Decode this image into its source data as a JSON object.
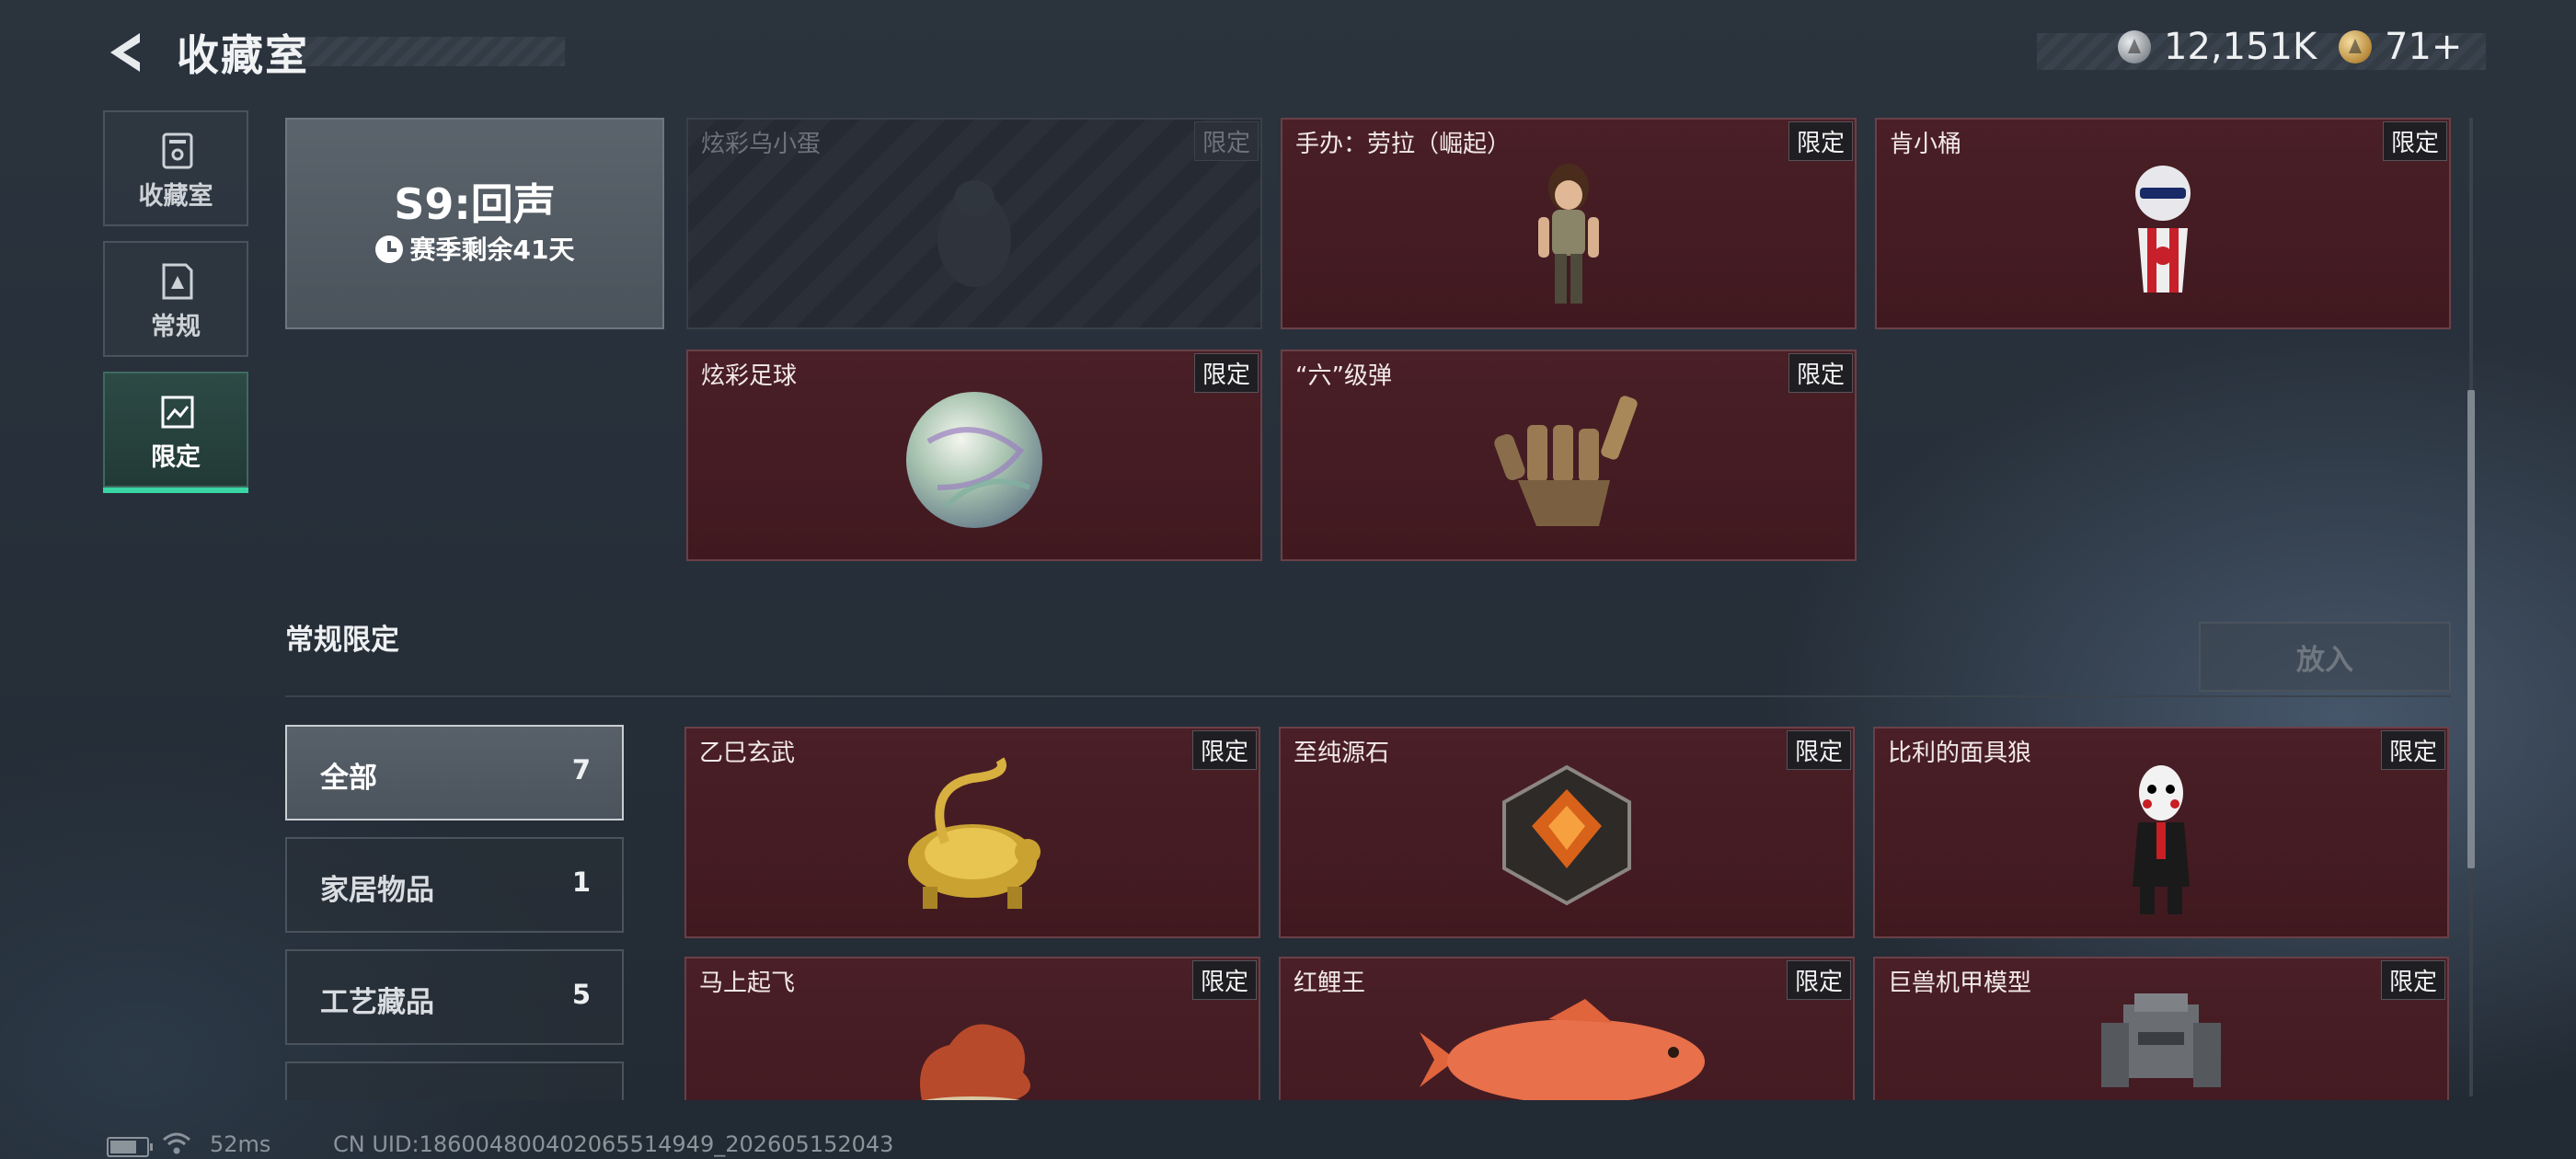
{
  "header": {
    "title": "收藏室"
  },
  "currency": {
    "silver": "12,151K",
    "gold": "71+"
  },
  "sidebar": {
    "items": [
      {
        "label": "收藏室",
        "icon": "trash-bin-icon"
      },
      {
        "label": "常规",
        "icon": "document-icon"
      },
      {
        "label": "限定",
        "icon": "picture-icon",
        "active": true
      }
    ]
  },
  "season": {
    "title": "S9:回声",
    "remaining": "赛季剩余41天"
  },
  "badge_label": "限定",
  "season_items": [
    {
      "name": "炫彩乌小蛋",
      "locked": true
    },
    {
      "name": "手办：劳拉（崛起）"
    },
    {
      "name": "肯小桶"
    },
    {
      "name": "炫彩足球"
    },
    {
      "name": "“六”级弹"
    }
  ],
  "section": {
    "title": "常规限定",
    "put_button": "放入"
  },
  "filters": [
    {
      "label": "全部",
      "count": "7",
      "active": true
    },
    {
      "label": "家居物品",
      "count": "1"
    },
    {
      "label": "工艺藏品",
      "count": "5"
    }
  ],
  "regular_items": [
    {
      "name": "乙巳玄武"
    },
    {
      "name": "至纯源石"
    },
    {
      "name": "比利的面具狼"
    },
    {
      "name": "马上起飞"
    },
    {
      "name": "红鲤王"
    },
    {
      "name": "巨兽机甲模型"
    }
  ],
  "status": {
    "ping": "52ms",
    "uid": "CN UID:18600480040206551494​9_202605152043"
  },
  "colors": {
    "accent": "#3ad6a4",
    "card_red": "#4a1f27"
  }
}
